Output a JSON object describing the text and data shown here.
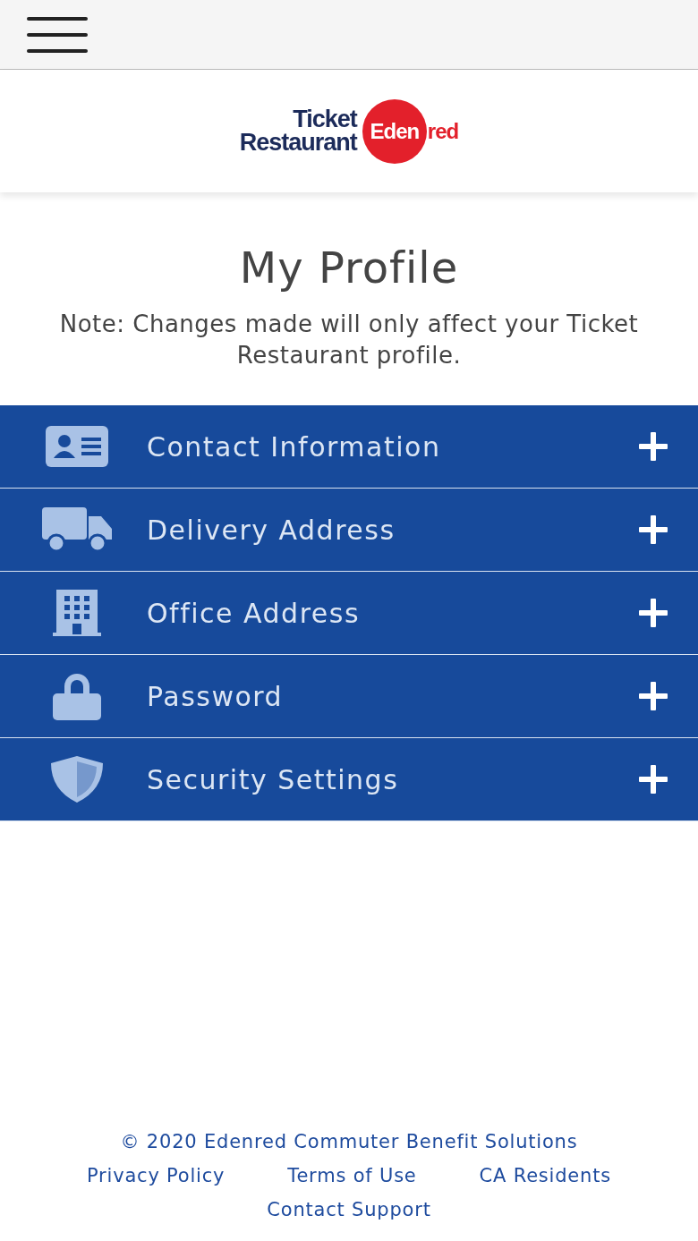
{
  "logo": {
    "line_1": "Ticket",
    "line_2": "Restaurant",
    "brand_1": "Eden",
    "brand_2": "red"
  },
  "title": "My Profile",
  "note": "Note: Changes made will only affect your Ticket Restaurant profile.",
  "sections": [
    {
      "kind": "contact",
      "label": "Contact Information",
      "expanded": false
    },
    {
      "kind": "delivery",
      "label": "Delivery Address",
      "expanded": false
    },
    {
      "kind": "office",
      "label": "Office Address",
      "expanded": false
    },
    {
      "kind": "password",
      "label": "Password",
      "expanded": false
    },
    {
      "kind": "security",
      "label": "Security Settings",
      "expanded": false
    }
  ],
  "footer": {
    "copyright": "© 2020 Edenred Commuter Benefit Solutions",
    "links": [
      "Privacy Policy",
      "Terms of Use",
      "CA Residents"
    ],
    "support": "Contact Support"
  }
}
